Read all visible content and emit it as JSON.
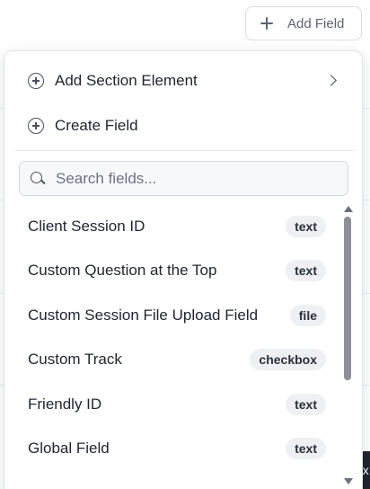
{
  "toolbar": {
    "add_field_label": "Add Field"
  },
  "background": {
    "peek_text": "ex"
  },
  "dropdown": {
    "menu_items": [
      {
        "label": "Add Section Element",
        "icon": "circle-plus-icon",
        "has_submenu": true
      },
      {
        "label": "Create Field",
        "icon": "circle-plus-icon",
        "has_submenu": false
      }
    ],
    "search": {
      "placeholder": "Search fields...",
      "value": ""
    },
    "fields": [
      {
        "name": "Client Session ID",
        "type": "text"
      },
      {
        "name": "Custom Question at the Top",
        "type": "text"
      },
      {
        "name": "Custom Session File Upload Field",
        "type": "file"
      },
      {
        "name": "Custom Track",
        "type": "checkbox"
      },
      {
        "name": "Friendly ID",
        "type": "text"
      },
      {
        "name": "Global Field",
        "type": "text"
      }
    ]
  }
}
